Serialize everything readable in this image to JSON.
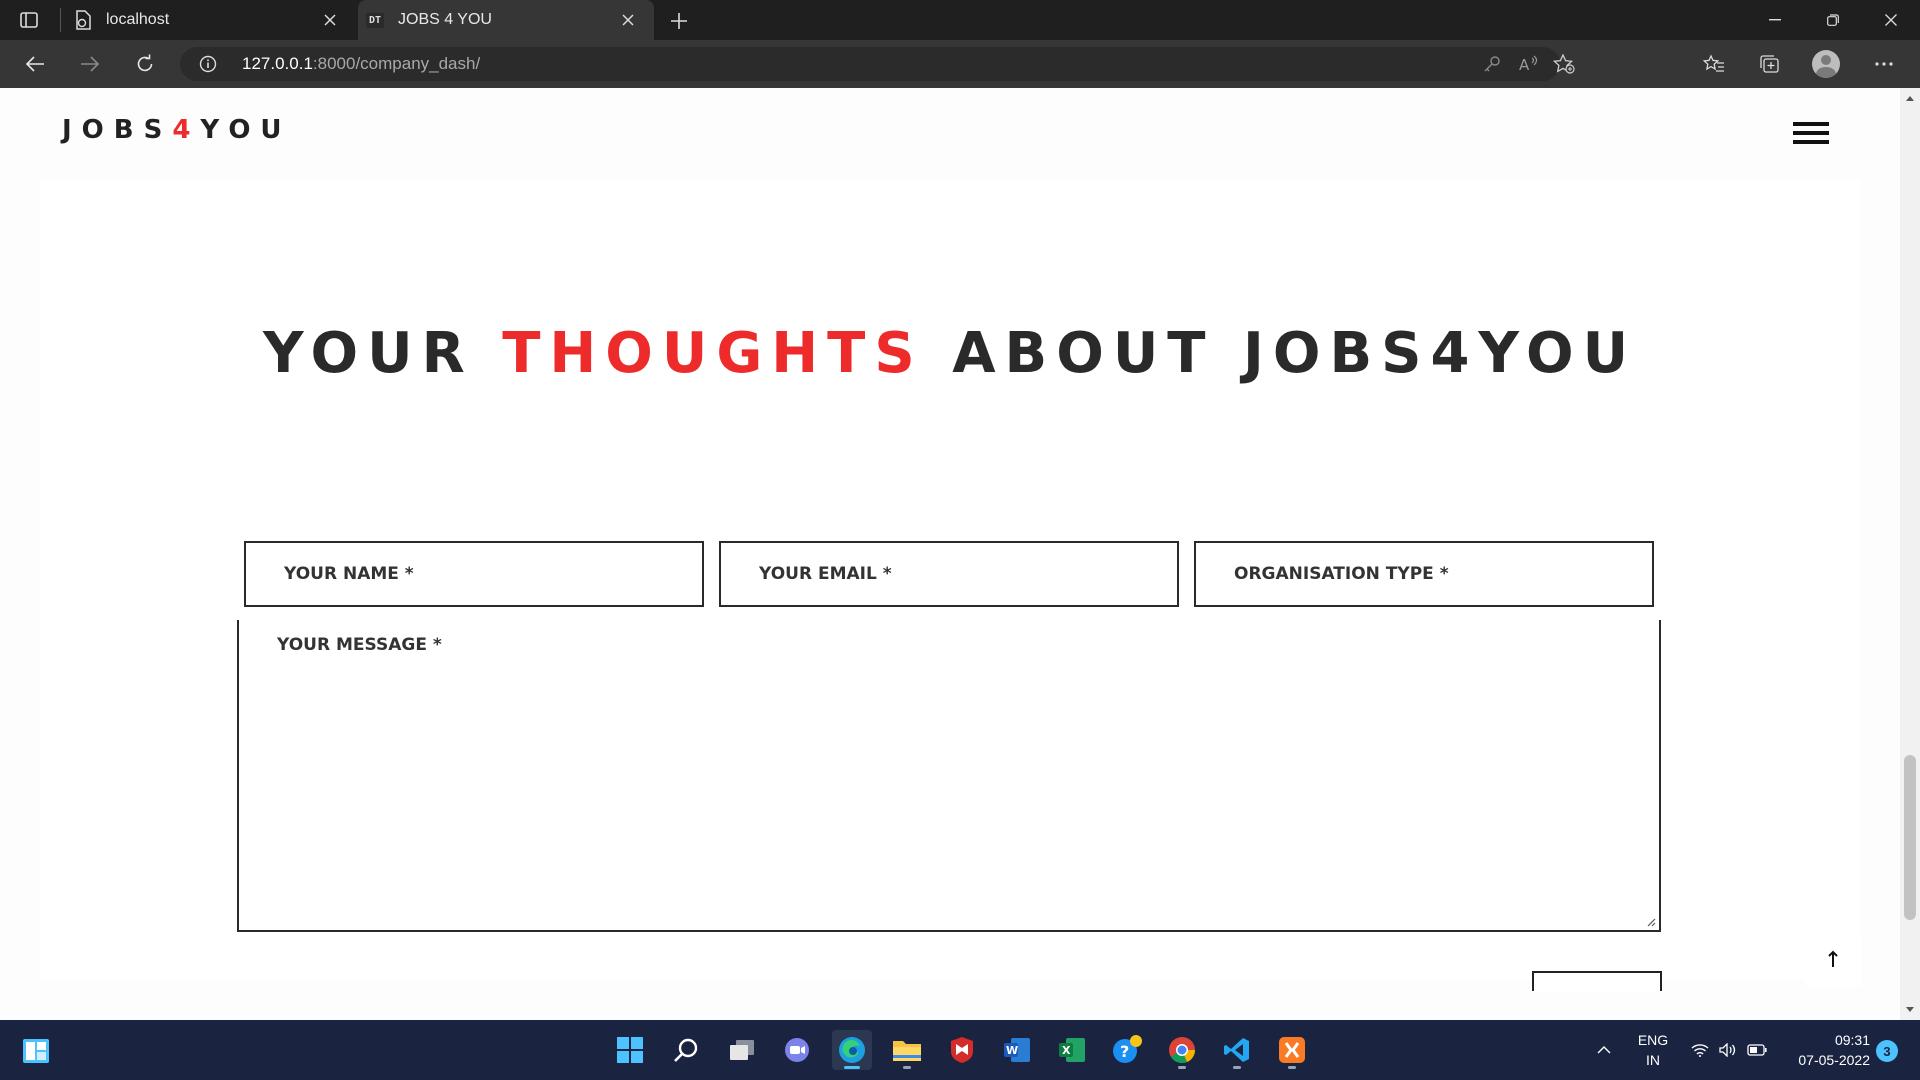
{
  "browser": {
    "tabs": [
      {
        "title": "localhost",
        "icon": "page-sync-icon",
        "active": false
      },
      {
        "title": "JOBS 4 YOU",
        "favicon_text": "DT",
        "active": true
      }
    ],
    "address": {
      "host": "127.0.0.1",
      "path": ":8000/company_dash/"
    }
  },
  "site": {
    "logo": {
      "prefix": "JOBS",
      "accent": "4",
      "suffix": "YOU"
    },
    "colors": {
      "accent": "#ee2b2b",
      "text": "#2a2a2a"
    }
  },
  "feedback": {
    "heading": {
      "before": "YOUR ",
      "highlight": "THOUGHTS",
      "after": " ABOUT JOBS4YOU"
    },
    "fields": {
      "name_placeholder": "YOUR NAME *",
      "email_placeholder": "YOUR EMAIL *",
      "org_placeholder": "ORGANISATION TYPE *",
      "message_placeholder": "YOUR MESSAGE *"
    }
  },
  "taskbar": {
    "apps": [
      "start-icon",
      "search-icon",
      "task-view-icon",
      "chat-icon",
      "edge-icon",
      "file-explorer-icon",
      "mcafee-icon",
      "word-icon",
      "excel-icon",
      "help-icon",
      "chrome-icon",
      "vscode-icon",
      "xampp-icon"
    ],
    "language": {
      "line1": "ENG",
      "line2": "IN"
    },
    "time": "09:31",
    "date": "07-05-2022",
    "notifications": "3"
  }
}
